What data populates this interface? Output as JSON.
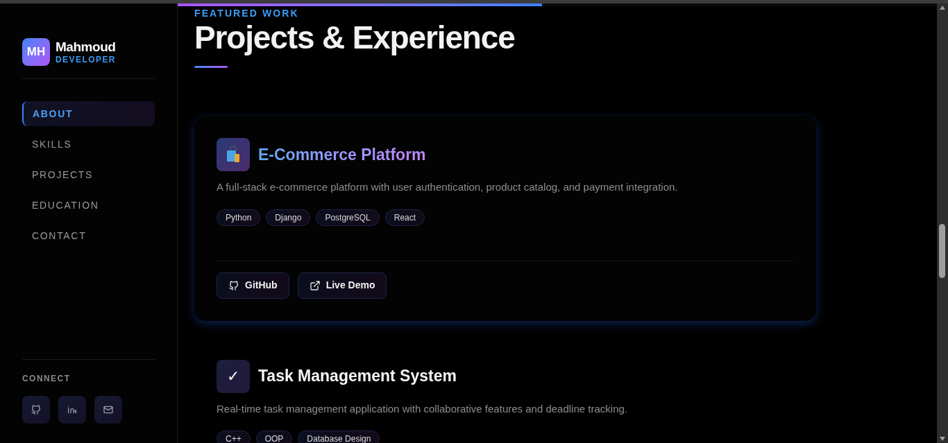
{
  "scroll_progress": {
    "level": 0.48
  },
  "sidebar": {
    "logo": {
      "initials": "MH",
      "name": "Mahmoud",
      "role": "DEVELOPER"
    },
    "items": [
      {
        "label": "ABOUT",
        "selected": true
      },
      {
        "label": "SKILLS",
        "selected": false
      },
      {
        "label": "PROJECTS",
        "selected": false
      },
      {
        "label": "EDUCATION",
        "selected": false
      },
      {
        "label": "CONTACT",
        "selected": false
      }
    ],
    "connect": {
      "heading": "CONNECT",
      "links": [
        {
          "kind": "github"
        },
        {
          "kind": "linkedin"
        },
        {
          "kind": "email"
        }
      ]
    }
  },
  "section": {
    "eyebrow": "FEATURED WORK",
    "title": "Projects & Experience"
  },
  "projects": [
    {
      "title": "E-Commerce Platform",
      "highlighted": true,
      "description": "A full-stack e-commerce platform with user authentication, product catalog, and payment integration.",
      "tags": [
        "Python",
        "Django",
        "PostgreSQL",
        "React"
      ],
      "buttons": [
        {
          "kind": "github",
          "label": "GitHub"
        },
        {
          "kind": "external",
          "label": "Live Demo"
        }
      ]
    },
    {
      "glyph": "✓",
      "title": "Task Management System",
      "highlighted": false,
      "description": "Real-time task management application with collaborative features and deadline tracking.",
      "tags": [
        "C++",
        "OOP",
        "Database Design"
      ]
    }
  ]
}
